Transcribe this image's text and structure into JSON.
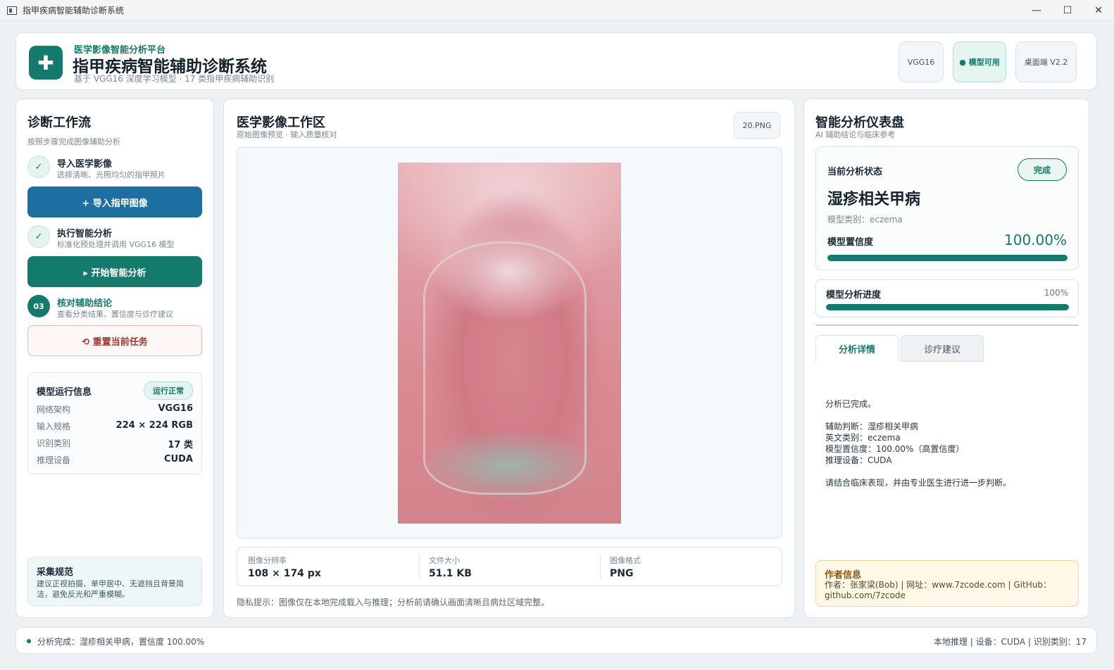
{
  "window": {
    "title": "指甲疾病智能辅助诊断系统",
    "controls": {
      "minimize": "—",
      "maximize": "☐",
      "close": "✕"
    }
  },
  "header": {
    "logo_glyph": "✚",
    "eyebrow": "医学影像智能分析平台",
    "title": "指甲疾病智能辅助诊断系统",
    "subtitle": "基于 VGG16 深度学习模型 · 17 类指甲疾病辅助识别",
    "pills": [
      "VGG16",
      "● 模型可用",
      "桌面端 V2.2"
    ]
  },
  "workflow": {
    "title": "诊断工作流",
    "subtitle": "按照步骤完成图像辅助分析",
    "steps": [
      {
        "marker": "✓",
        "title": "导入医学影像",
        "desc": "选择清晰、光照均匀的指甲照片"
      },
      {
        "marker": "✓",
        "title": "执行智能分析",
        "desc": "标准化预处理并调用 VGG16 模型"
      },
      {
        "marker": "03",
        "title": "核对辅助结论",
        "desc": "查看分类结果、置信度与诊疗建议"
      }
    ],
    "import_button": "+ 导入指甲图像",
    "analyze_button": "▸ 开始智能分析",
    "reset_button": "⟲ 重置当前任务"
  },
  "model_info": {
    "title": "模型运行信息",
    "badge": "运行正常",
    "rows": [
      {
        "k": "网络架构",
        "v": "VGG16"
      },
      {
        "k": "输入规格",
        "v": "224 × 224 RGB"
      },
      {
        "k": "识别类别",
        "v": "17 类"
      },
      {
        "k": "推理设备",
        "v": "CUDA"
      }
    ]
  },
  "tips": {
    "title": "采集规范",
    "text": "建议正视拍摄、单甲居中、无遮挡且背景简洁，避免反光和严重模糊。"
  },
  "workspace": {
    "title": "医学影像工作区",
    "subtitle": "原始图像预览 · 输入质量核对",
    "file_name": "20.PNG",
    "meta": [
      {
        "k": "图像分辨率",
        "v": "108 × 174 px"
      },
      {
        "k": "文件大小",
        "v": "51.1 KB"
      },
      {
        "k": "图像格式",
        "v": "PNG"
      }
    ],
    "privacy": "隐私提示：图像仅在本地完成载入与推理；分析前请确认画面清晰且病灶区域完整。"
  },
  "dashboard": {
    "title": "智能分析仪表盘",
    "subtitle": "AI 辅助结论与临床参考",
    "status_label": "当前分析状态",
    "status_badge": "完成",
    "diagnosis": "湿疹相关甲病",
    "model_class": "模型类别：eczema",
    "confidence_label": "模型置信度",
    "confidence_value": "100.00%",
    "confidence_fraction": 1.0,
    "progress_label": "模型分析进度",
    "progress_value": "100%",
    "progress_fraction": 1.0,
    "tabs": [
      "分析详情",
      "诊疗建议"
    ],
    "detail_text": "分析已完成。\n\n辅助判断：湿疹相关甲病\n英文类别：eczema\n模型置信度：100.00%（高置信度）\n推理设备：CUDA\n\n请结合临床表现，并由专业医生进行进一步判断。",
    "author_title": "作者信息",
    "author_text": "作者：张家梁(Bob) | 网址：www.7zcode.com | GitHub：github.com/7zcode"
  },
  "statusbar": {
    "left": "分析完成：湿疹相关甲病，置信度 100.00%",
    "right": "本地推理 | 设备：CUDA | 识别类别：17"
  },
  "colors": {
    "accent": "#137a6c",
    "primary_button": "#1d6ea1",
    "reset_border": "#eab8b2"
  }
}
